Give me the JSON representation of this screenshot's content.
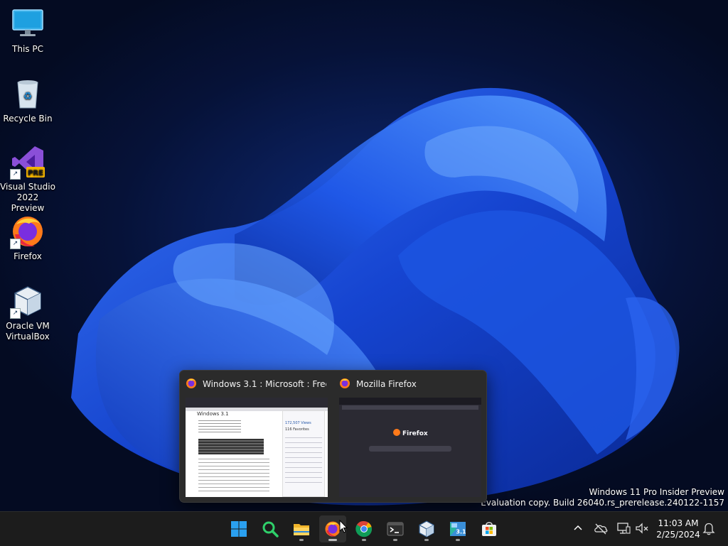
{
  "desktop": {
    "icons": [
      {
        "label": "This PC",
        "icon": "this-pc-icon"
      },
      {
        "label": "Recycle Bin",
        "icon": "recycle-bin-icon"
      },
      {
        "label": "Visual Studio\n2022 Preview",
        "icon": "visual-studio-icon",
        "badge": "PRE"
      },
      {
        "label": "Firefox",
        "icon": "firefox-icon"
      },
      {
        "label": "Oracle VM\nVirtualBox",
        "icon": "virtualbox-icon"
      }
    ],
    "watermark": {
      "line1": "Windows 11 Pro Insider Preview",
      "line2": "Evaluation copy. Build 26040.rs_prerelease.240122-1157"
    }
  },
  "thumbnails": [
    {
      "title": "Windows 3.1 : Microsoft : Free ...",
      "preview": {
        "heading": "Windows 3.1",
        "views": "172,507 Views",
        "favorites": "116 Favorites"
      }
    },
    {
      "title": "Mozilla Firefox",
      "preview": {
        "logo_text": "Firefox"
      }
    }
  ],
  "taskbar": {
    "apps": [
      "start-icon",
      "search-icon",
      "file-explorer-icon",
      "firefox-icon",
      "chrome-icon",
      "terminal-icon",
      "virtualbox-icon",
      "windows-3-1-icon",
      "store-icon"
    ],
    "win31_label": "3.1",
    "tray": [
      "chevron-up-icon",
      "onedrive-icon",
      "network-icon",
      "volume-muted-icon"
    ],
    "clock": {
      "time": "11:03 AM",
      "date": "2/25/2024"
    }
  },
  "colors": {
    "accent": "#0078d4",
    "taskbar_bg": "#1c1c1c",
    "flyout_bg": "#2b2b2b",
    "wallpaper": "#0a1d55"
  }
}
